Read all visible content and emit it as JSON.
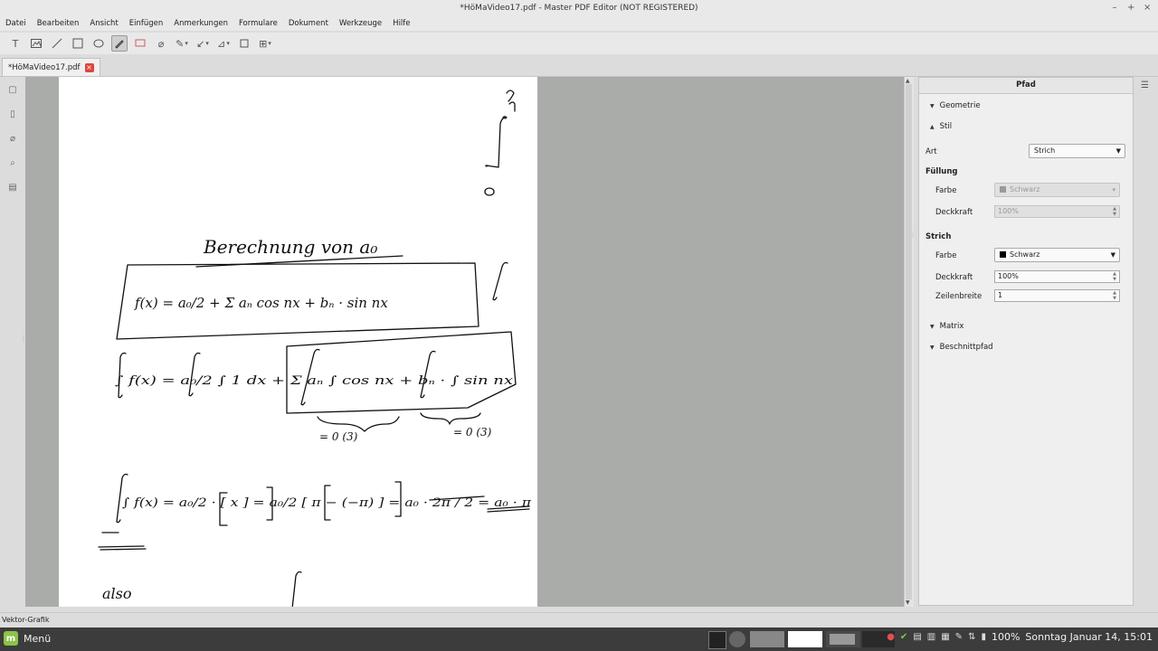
{
  "window": {
    "title": "*HöMaVideo17.pdf - Master PDF Editor (NOT REGISTERED)"
  },
  "menu": [
    "Datei",
    "Bearbeiten",
    "Ansicht",
    "Einfügen",
    "Anmerkungen",
    "Formulare",
    "Dokument",
    "Werkzeuge",
    "Hilfe"
  ],
  "tab": {
    "label": "*HöMaVideo17.pdf"
  },
  "panel": {
    "title": "Pfad",
    "geometrie": "Geometrie",
    "stil": "Stil",
    "art_label": "Art",
    "art_value": "Strich",
    "fuellung": "Füllung",
    "fuellung_farbe_label": "Farbe",
    "fuellung_farbe_value": "Schwarz",
    "fuellung_deckkraft_label": "Deckkraft",
    "fuellung_deckkraft_value": "100%",
    "strich": "Strich",
    "strich_farbe_label": "Farbe",
    "strich_farbe_value": "Schwarz",
    "strich_deckkraft_label": "Deckkraft",
    "strich_deckkraft_value": "100%",
    "zeilenbreite_label": "Zeilenbreite",
    "zeilenbreite_value": "1",
    "matrix": "Matrix",
    "beschnittpfad": "Beschnittpfad"
  },
  "status": {
    "text": "Vektor-Grafik"
  },
  "taskbar": {
    "menu_label": "Menü",
    "battery": "100%",
    "clock": "Sonntag Januar 14, 15:01"
  },
  "page_text": {
    "heading": "Berechnung von a₀",
    "eq1": "f(x) = a₀/2 + Σ aₙ cos nx + bₙ · sin nx",
    "eq2": "∫ f(x) = a₀/2 ∫ 1 dx + Σ aₙ ∫ cos nx + bₙ · ∫ sin nx",
    "zero1": "= 0 (3)",
    "zero2": "= 0 (3)",
    "eq3": "∫ f(x) = a₀/2 · [ x ] = a₀/2 [ π − (−π) ] = a₀ · 2π / 2 = a₀ · π",
    "also": "also"
  },
  "colors": {
    "accent": "#e0453a",
    "page": "#ffffff",
    "canvas": "#a9aca8",
    "taskbar": "#3c3c3c"
  }
}
